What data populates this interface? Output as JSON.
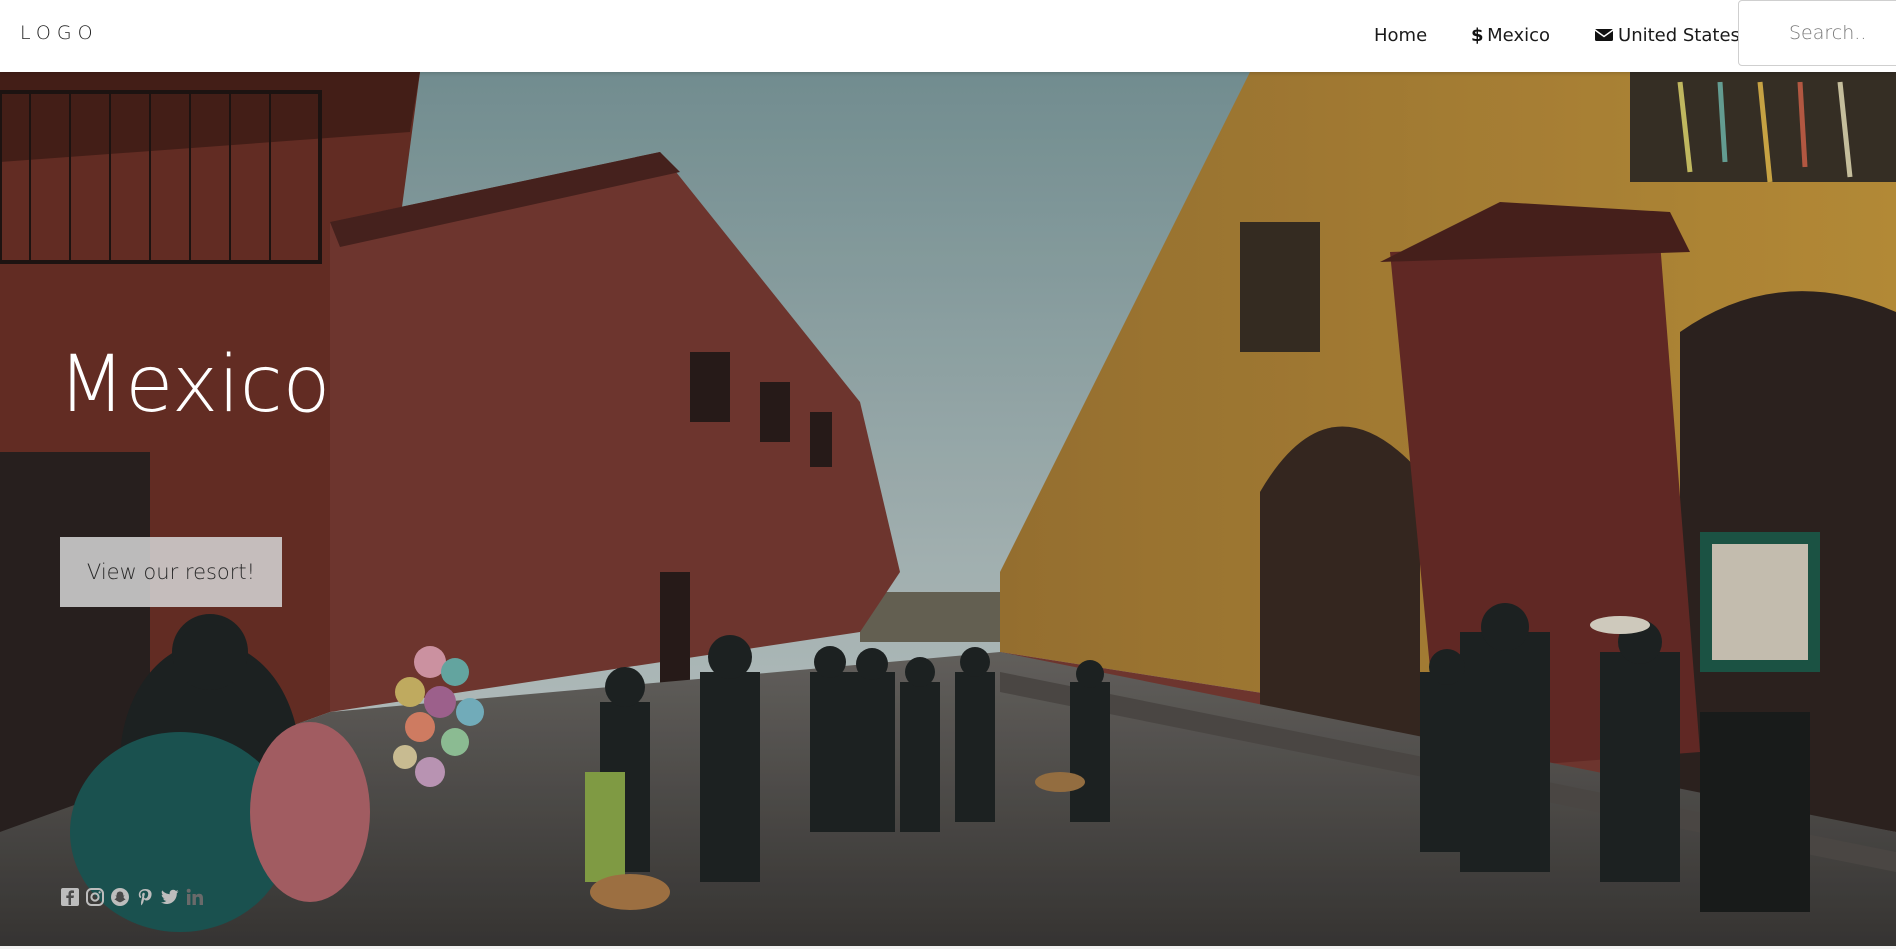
{
  "navbar": {
    "logo": "LOGO",
    "links": [
      {
        "label": "Home",
        "icon": null
      },
      {
        "label": "Mexico",
        "icon": "dollar-icon"
      },
      {
        "label": "United States",
        "icon": "envelope-icon"
      }
    ],
    "search_placeholder": "Search.."
  },
  "hero": {
    "title": "Mexico",
    "button_label": "View our resort!",
    "social_icons": [
      "facebook-icon",
      "instagram-icon",
      "snapchat-icon",
      "pinterest-icon",
      "twitter-icon",
      "linkedin-icon"
    ]
  },
  "colors": {
    "navbar_bg": "#ffffff",
    "hero_text": "#ffffff",
    "button_bg": "#d7d7d7",
    "sky": "#9fb3b6",
    "yellow_wall": "#c99a3c",
    "red_wall": "#7a3b33"
  }
}
